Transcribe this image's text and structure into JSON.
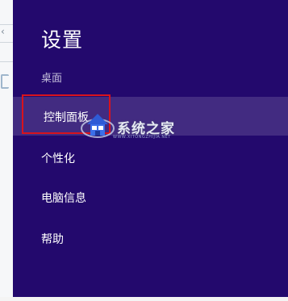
{
  "settings_panel": {
    "title": "设置",
    "context": "桌面",
    "items": [
      {
        "label": "控制面板",
        "highlighted": true
      },
      {
        "label": "个性化",
        "highlighted": false
      },
      {
        "label": "电脑信息",
        "highlighted": false
      },
      {
        "label": "帮助",
        "highlighted": false
      }
    ]
  },
  "watermark": {
    "name": "系统之家",
    "url": "WWW.XITONGZHIJIA.NET"
  },
  "colors": {
    "panel_background": "#23096d",
    "highlight_border": "#d8131d"
  }
}
